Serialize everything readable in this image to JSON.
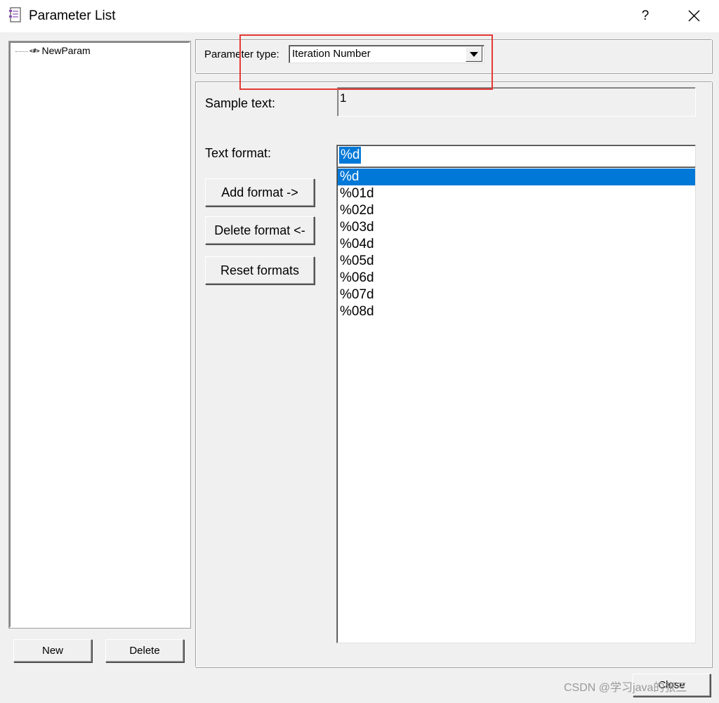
{
  "window": {
    "title": "Parameter List",
    "help_label": "?"
  },
  "tree": {
    "items": [
      {
        "glyph": "<#>",
        "label": "NewParam"
      }
    ]
  },
  "left_buttons": {
    "new_label": "New",
    "delete_label": "Delete"
  },
  "parameter_type": {
    "label": "Parameter type:",
    "selected": "Iteration Number"
  },
  "sample": {
    "label": "Sample text:",
    "value": "1"
  },
  "text_format": {
    "label": "Text format:",
    "value": "%d",
    "add_label": "Add format ->",
    "delete_label": "Delete format <-",
    "reset_label": "Reset formats",
    "formats": [
      "%d",
      "%01d",
      "%02d",
      "%03d",
      "%04d",
      "%05d",
      "%06d",
      "%07d",
      "%08d"
    ],
    "selected_index": 0
  },
  "close_label": "Close",
  "watermark": "CSDN @学习java的张三",
  "colors": {
    "selection": "#0078d7",
    "highlight_box": "#e53935"
  }
}
